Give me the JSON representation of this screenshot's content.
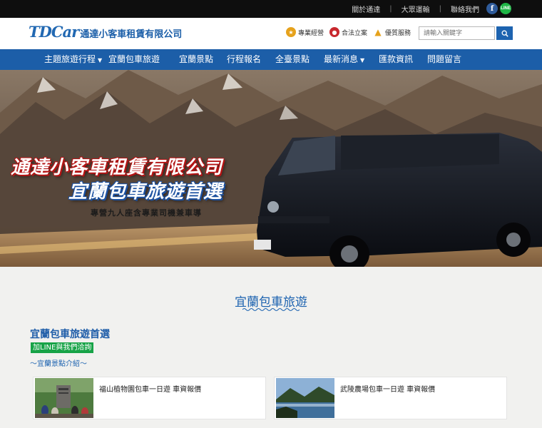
{
  "topbar": {
    "links": [
      "關於通達",
      "大眾運輸",
      "聯絡我們"
    ],
    "social": {
      "facebook": "f",
      "line": "LINE"
    }
  },
  "header": {
    "logo_mark": "TDCar",
    "logo_name": "通達小客車租賃有限公司",
    "badges": [
      {
        "icon": "star-icon",
        "label": "專業經營"
      },
      {
        "icon": "medal-icon",
        "label": "合法立案"
      },
      {
        "icon": "thumbs-up-icon",
        "label": "優質服務"
      }
    ],
    "search": {
      "placeholder": "請輸入關鍵字"
    }
  },
  "nav": {
    "items": [
      {
        "label": "主題旅遊行程",
        "dropdown": true
      },
      {
        "label": "宜蘭包車旅遊",
        "dropdown": false
      },
      {
        "label": "宜蘭景點",
        "dropdown": false
      },
      {
        "label": "行程報名",
        "dropdown": false
      },
      {
        "label": "全臺景點",
        "dropdown": false
      },
      {
        "label": "最新消息",
        "dropdown": true
      },
      {
        "label": "匯款資訊",
        "dropdown": false
      },
      {
        "label": "問題留言",
        "dropdown": false
      }
    ]
  },
  "hero": {
    "line1": "通達小客車租賃有限公司",
    "line2": "宜蘭包車旅遊首選",
    "line3": "專營九人座含專業司機兼車導"
  },
  "content": {
    "section_title": "宜蘭包車旅遊",
    "sub_title": "宜蘭包車旅遊首選",
    "line_button": "加LINE與我們洽詢",
    "intro_link": "～宜蘭景點介紹～",
    "cards": [
      {
        "title": "福山植物園包車一日遊 車資報價"
      },
      {
        "title": "武陵農場包車一日遊 車資報價"
      }
    ]
  },
  "colors": {
    "brand_blue": "#1c5ea8",
    "line_green": "#17a347",
    "topbar_black": "#0e0e0e"
  }
}
